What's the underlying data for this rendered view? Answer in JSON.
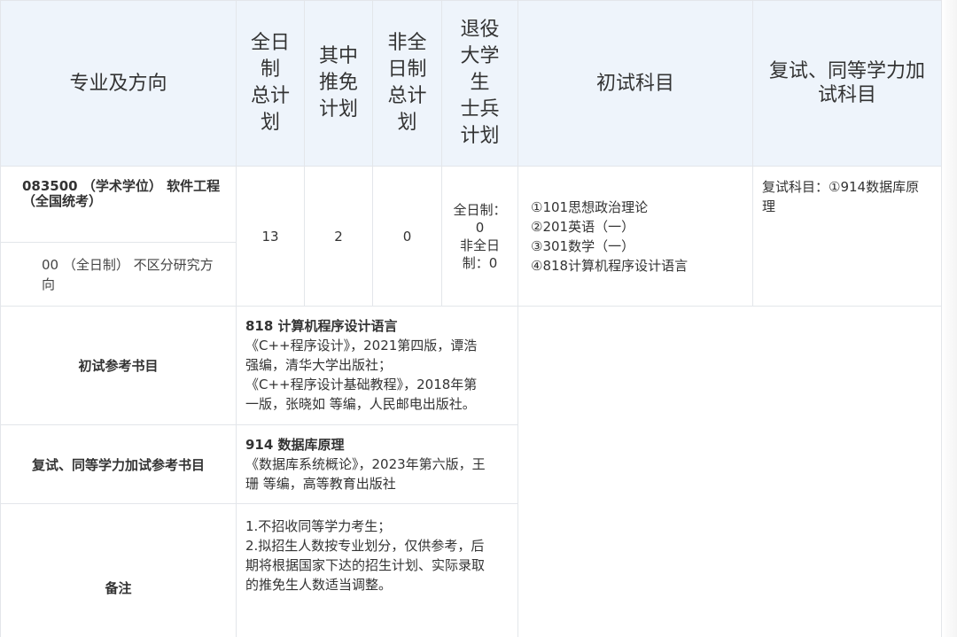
{
  "header": {
    "major_direction": "专业及方向",
    "fulltime_plan_lines": [
      "全日",
      "制",
      "总计",
      "划"
    ],
    "recommended_plan_lines": [
      "其中",
      "推免",
      "计划"
    ],
    "parttime_plan_lines": [
      "非全",
      "日制",
      "总计",
      "划"
    ],
    "veteran_plan_lines": [
      "退役",
      "大学",
      "生",
      "士兵",
      "计划"
    ],
    "initial_subjects": "初试科目",
    "retest_lines": [
      "复试、同等学力加",
      "试科目"
    ]
  },
  "program": {
    "major_title_lines": [
      "083500 （学术学位） 软件工程",
      "（全国统考）"
    ],
    "direction_lines": [
      "00 （全日制） 不区分研究方",
      "向"
    ],
    "fulltime_total": "13",
    "recommended": "2",
    "parttime_total": "0",
    "veteran_lines": [
      "全日制：",
      "0",
      "非全日",
      "制：0"
    ],
    "initial_subjects": [
      "①101思想政治理论",
      "②201英语（一）",
      "③301数学（一）",
      "④818计算机程序设计语言"
    ],
    "retest_lines": [
      "复试科目：①914数据库原",
      "理"
    ]
  },
  "initial_books": {
    "label": "初试参考书目",
    "title": "818 计算机程序设计语言",
    "lines": [
      "《C++程序设计》，2021第四版，谭浩",
      "强编，清华大学出版社；",
      "《C++程序设计基础教程》，2018年第",
      "一版，张晓如 等编，人民邮电出版社。"
    ]
  },
  "retest_books": {
    "label": "复试、同等学力加试参考书目",
    "title": "914 数据库原理",
    "lines": [
      "《数据库系统概论》，2023年第六版，王",
      "珊 等编，高等教育出版社"
    ]
  },
  "remarks": {
    "label": "备注",
    "lines": [
      "1.不招收同等学力考生；",
      "2.拟招生人数按专业划分，仅供参考，后",
      "期将根据国家下达的招生计划、实际录取",
      "的推免生人数适当调整。"
    ]
  },
  "colors": {
    "header_bg": "#eef4fb",
    "header_border": "#1fa0e0",
    "grid_line": "#e3e6ea"
  }
}
